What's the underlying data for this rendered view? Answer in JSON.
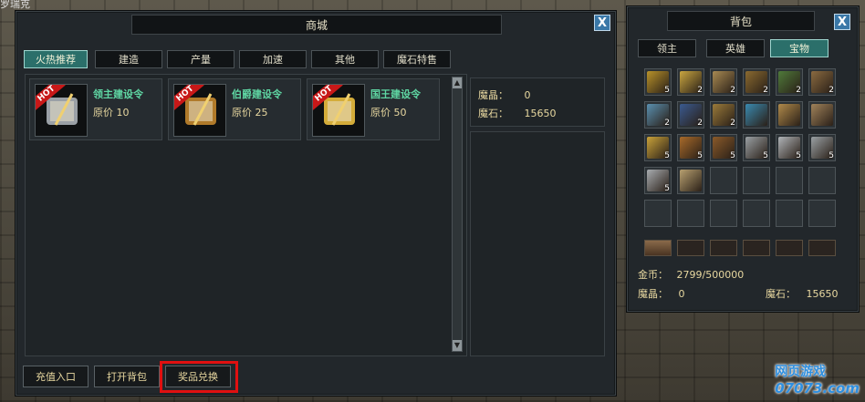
{
  "corner_text": "罗瑞克",
  "shop": {
    "title": "商城",
    "close": "X",
    "tabs": [
      {
        "label": "火热推荐",
        "active": true
      },
      {
        "label": "建造",
        "active": false
      },
      {
        "label": "产量",
        "active": false
      },
      {
        "label": "加速",
        "active": false
      },
      {
        "label": "其他",
        "active": false
      },
      {
        "label": "魔石特售",
        "active": false
      }
    ],
    "items": [
      {
        "name": "领主建设令",
        "price": "原价 10",
        "badge": "HOT",
        "icon": "scroll-quill-icon"
      },
      {
        "name": "伯爵建设令",
        "price": "原价 25",
        "badge": "HOT",
        "icon": "scroll-gold-quill-icon"
      },
      {
        "name": "国王建设令",
        "price": "原价 50",
        "badge": "HOT",
        "icon": "scroll-crown-icon"
      }
    ],
    "crystal_label": "魔晶：",
    "crystal_value": "0",
    "stone_label": "魔石：",
    "stone_value": "15650",
    "buttons": {
      "recharge": "充值入口",
      "open_bag": "打开背包",
      "prize_exchange": "奖品兑换"
    }
  },
  "bag": {
    "title": "背包",
    "close": "X",
    "tabs": [
      {
        "label": "领主",
        "active": false
      },
      {
        "label": "英雄",
        "active": false
      },
      {
        "label": "宝物",
        "active": true
      }
    ],
    "slots": [
      {
        "icon": "shield-icon",
        "count": "5",
        "color": "#b8922a"
      },
      {
        "icon": "scroll-icon",
        "count": "2",
        "color": "#c9a640"
      },
      {
        "icon": "scroll-icon",
        "count": "2",
        "color": "#a88a52"
      },
      {
        "icon": "book-icon",
        "count": "2",
        "color": "#8a6a30"
      },
      {
        "icon": "chest-icon",
        "count": "2",
        "color": "#4f7a3a"
      },
      {
        "icon": "chest-icon",
        "count": "2",
        "color": "#8a6a40"
      },
      {
        "icon": "chest-icon",
        "count": "2",
        "color": "#5a90b0"
      },
      {
        "icon": "chest-icon",
        "count": "2",
        "color": "#3a5a90"
      },
      {
        "icon": "chest-icon",
        "count": "2",
        "color": "#9a7a3a"
      },
      {
        "icon": "ring-icon",
        "count": "",
        "color": "#3a8ab0"
      },
      {
        "icon": "helmet-icon",
        "count": "",
        "color": "#b08a4a"
      },
      {
        "icon": "box-icon",
        "count": "",
        "color": "#a0825a"
      },
      {
        "icon": "crown-icon",
        "count": "5",
        "color": "#c9a23a"
      },
      {
        "icon": "quill-icon",
        "count": "5",
        "color": "#a86a2a"
      },
      {
        "icon": "quill-icon",
        "count": "5",
        "color": "#8a5a2a"
      },
      {
        "icon": "scroll-icon",
        "count": "5",
        "color": "#9aa0a4"
      },
      {
        "icon": "scroll-icon",
        "count": "5",
        "color": "#b0b4b8"
      },
      {
        "icon": "scroll-icon",
        "count": "5",
        "color": "#9aa0a4"
      },
      {
        "icon": "scroll-icon",
        "count": "5",
        "color": "#a8acb0"
      },
      {
        "icon": "map-icon",
        "count": "",
        "color": "#b8a070"
      }
    ],
    "gold_label": "金币：",
    "gold_value": "2799/500000",
    "crystal_label": "魔晶：",
    "crystal_value": "0",
    "stone_label": "魔石：",
    "stone_value": "15650"
  },
  "logo": {
    "line1": "网页游戏",
    "line2": "07073.com"
  }
}
